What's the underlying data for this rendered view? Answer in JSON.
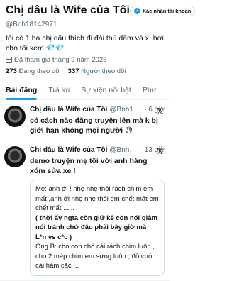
{
  "profile": {
    "display_name": "Chị dâu là Wife của Tôi",
    "verify_label": "Xác nhận tài khoản",
    "handle": "@Bnh18142971",
    "bio": "tôi có 1 bà chị dâu thích đi đái thủ dâm và xì hơi cho tôi xem 💎💎",
    "joined": "Đã tham gia tháng 9 năm 2023",
    "following_count": "273",
    "following_label": "Đang theo dõi",
    "followers_count": "337",
    "followers_label": "Người theo dõi"
  },
  "tabs": [
    "Bài đăng",
    "Trả lời",
    "Sự kiện nổi bật",
    "Phư"
  ],
  "tweets": [
    {
      "name": "Chị dâu là Wife của Tôi",
      "handle": "@Bnh181...",
      "time": "· 6 giờ",
      "text": "có cách nào đăng truyện lên mà k bị giới hạn không mọi người 😢"
    },
    {
      "name": "Chị dâu là Wife của Tôi",
      "handle": "@Bnh18...",
      "time": "· 13 giờ",
      "text": "demo truyện mẹ tôi với anh hàng xóm sửa xe !",
      "quote": [
        "Mẹ: anh ới ! nhẹ nhẹ thôi rách chim em mất ,anh ới nhẹ nhẹ thôi em chết mất em chết mất ......",
        "( thời ấy ngta còn giữ kẻ còn nói giảm nói tránh chứ đâu phải bây giờ mà L*n vs c*c )",
        "Ông B: cho con chó cái rách chim luôn , cho 2 mép chim em sưng luôn , đồ chó cái hám cặc ..."
      ]
    }
  ]
}
